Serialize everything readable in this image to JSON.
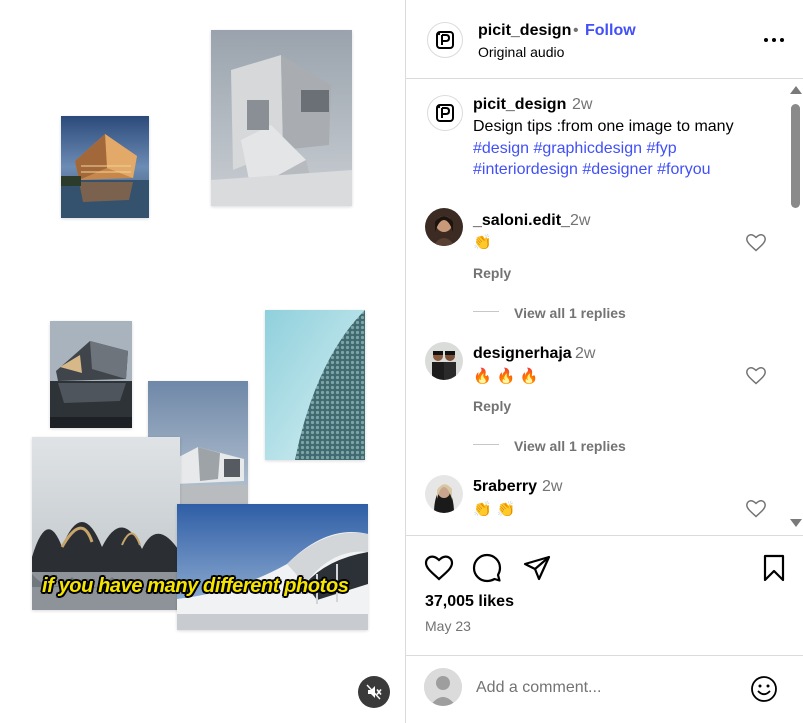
{
  "media": {
    "caption": "if you have many different photos"
  },
  "header": {
    "username": "picit_design",
    "separator": "•",
    "follow_label": "Follow",
    "audio": "Original audio",
    "more_icon": "more-horizontal-icon"
  },
  "post_caption": {
    "username": "picit_design",
    "time": "2w",
    "text": "Design tips :from one image to many",
    "hashtags_line1": "#design #graphicdesign #fyp",
    "hashtags_line2": "#interiordesign #designer #foryou"
  },
  "comments": [
    {
      "username": "_saloni.edit_",
      "time": "2w",
      "text": "👏",
      "reply_label": "Reply",
      "view_replies": "View all 1 replies"
    },
    {
      "username": "designerhaja",
      "time": "2w",
      "text": "🔥 🔥 🔥",
      "reply_label": "Reply",
      "view_replies": "View all 1 replies"
    },
    {
      "username": "5raberry",
      "time": "2w",
      "text": "👏 👏"
    }
  ],
  "actions": {
    "likes": "37,005 likes",
    "date": "May 23"
  },
  "add_comment": {
    "placeholder": "Add a comment..."
  },
  "colors": {
    "link_blue": "#4150f7",
    "secondary_text": "#737373",
    "border": "#dbdbdb",
    "caption_yellow": "#f5e400"
  }
}
